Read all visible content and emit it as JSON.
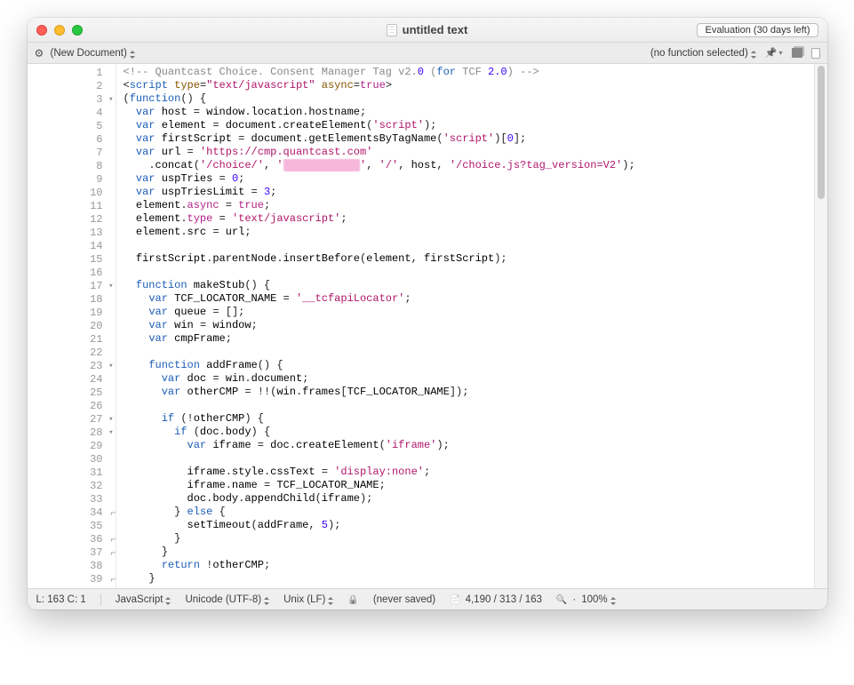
{
  "titlebar": {
    "title": "untitled text",
    "evaluation_badge": "Evaluation (30 days left)"
  },
  "toolbar": {
    "document_dropdown": "(New Document)",
    "function_dropdown": "(no function selected)"
  },
  "gutter": {
    "lines": [
      {
        "n": 1
      },
      {
        "n": 2
      },
      {
        "n": 3,
        "fold": "down"
      },
      {
        "n": 4
      },
      {
        "n": 5
      },
      {
        "n": 6
      },
      {
        "n": 7
      },
      {
        "n": 8
      },
      {
        "n": 9
      },
      {
        "n": 10
      },
      {
        "n": 11
      },
      {
        "n": 12
      },
      {
        "n": 13
      },
      {
        "n": 14
      },
      {
        "n": 15
      },
      {
        "n": 16
      },
      {
        "n": 17,
        "fold": "down"
      },
      {
        "n": 18
      },
      {
        "n": 19
      },
      {
        "n": 20
      },
      {
        "n": 21
      },
      {
        "n": 22
      },
      {
        "n": 23,
        "fold": "down"
      },
      {
        "n": 24
      },
      {
        "n": 25
      },
      {
        "n": 26
      },
      {
        "n": 27,
        "fold": "down"
      },
      {
        "n": 28,
        "fold": "down"
      },
      {
        "n": 29
      },
      {
        "n": 30
      },
      {
        "n": 31
      },
      {
        "n": 32
      },
      {
        "n": 33
      },
      {
        "n": 34,
        "fold": "up"
      },
      {
        "n": 35
      },
      {
        "n": 36,
        "fold": "up"
      },
      {
        "n": 37,
        "fold": "up"
      },
      {
        "n": 38
      },
      {
        "n": 39,
        "fold": "up"
      }
    ]
  },
  "code": {
    "lines": [
      [
        {
          "c": "c-comment",
          "t": "<!-- Quantcast Choice. Consent Manager Tag v2."
        },
        {
          "c": "c-num",
          "t": "0"
        },
        {
          "c": "c-comment",
          "t": " ("
        },
        {
          "c": "c-keyword",
          "t": "for"
        },
        {
          "c": "c-comment",
          "t": " TCF "
        },
        {
          "c": "c-num",
          "t": "2.0"
        },
        {
          "c": "c-comment",
          "t": ") -->"
        }
      ],
      [
        {
          "c": "c-punc",
          "t": "<"
        },
        {
          "c": "c-tag",
          "t": "script"
        },
        {
          "c": "txt",
          "t": " "
        },
        {
          "c": "c-attr",
          "t": "type"
        },
        {
          "c": "c-punc",
          "t": "="
        },
        {
          "c": "c-str2",
          "t": "\"text/javascript\""
        },
        {
          "c": "txt",
          "t": " "
        },
        {
          "c": "c-attr",
          "t": "async"
        },
        {
          "c": "c-punc",
          "t": "="
        },
        {
          "c": "c-bool",
          "t": "true"
        },
        {
          "c": "c-punc",
          "t": ">"
        }
      ],
      [
        {
          "c": "c-punc",
          "t": "("
        },
        {
          "c": "c-keyword",
          "t": "function"
        },
        {
          "c": "c-punc",
          "t": "() {"
        }
      ],
      [
        {
          "c": "txt",
          "t": "  "
        },
        {
          "c": "c-keyword",
          "t": "var"
        },
        {
          "c": "txt",
          "t": " host "
        },
        {
          "c": "c-punc",
          "t": "="
        },
        {
          "c": "txt",
          "t": " window"
        },
        {
          "c": "c-punc",
          "t": "."
        },
        {
          "c": "txt",
          "t": "location"
        },
        {
          "c": "c-punc",
          "t": "."
        },
        {
          "c": "txt",
          "t": "hostname"
        },
        {
          "c": "c-punc",
          "t": ";"
        }
      ],
      [
        {
          "c": "txt",
          "t": "  "
        },
        {
          "c": "c-keyword",
          "t": "var"
        },
        {
          "c": "txt",
          "t": " element "
        },
        {
          "c": "c-punc",
          "t": "="
        },
        {
          "c": "txt",
          "t": " document"
        },
        {
          "c": "c-punc",
          "t": "."
        },
        {
          "c": "txt",
          "t": "createElement"
        },
        {
          "c": "c-punc",
          "t": "("
        },
        {
          "c": "c-str2",
          "t": "'script'"
        },
        {
          "c": "c-punc",
          "t": ");"
        }
      ],
      [
        {
          "c": "txt",
          "t": "  "
        },
        {
          "c": "c-keyword",
          "t": "var"
        },
        {
          "c": "txt",
          "t": " firstScript "
        },
        {
          "c": "c-punc",
          "t": "="
        },
        {
          "c": "txt",
          "t": " document"
        },
        {
          "c": "c-punc",
          "t": "."
        },
        {
          "c": "txt",
          "t": "getElementsByTagName"
        },
        {
          "c": "c-punc",
          "t": "("
        },
        {
          "c": "c-str2",
          "t": "'script'"
        },
        {
          "c": "c-punc",
          "t": ")["
        },
        {
          "c": "c-num",
          "t": "0"
        },
        {
          "c": "c-punc",
          "t": "];"
        }
      ],
      [
        {
          "c": "txt",
          "t": "  "
        },
        {
          "c": "c-keyword",
          "t": "var"
        },
        {
          "c": "txt",
          "t": " url "
        },
        {
          "c": "c-punc",
          "t": "="
        },
        {
          "c": "txt",
          "t": " "
        },
        {
          "c": "c-str2",
          "t": "'https://cmp.quantcast.com'"
        }
      ],
      [
        {
          "c": "txt",
          "t": "    "
        },
        {
          "c": "c-punc",
          "t": "."
        },
        {
          "c": "txt",
          "t": "concat"
        },
        {
          "c": "c-punc",
          "t": "("
        },
        {
          "c": "c-str2",
          "t": "'/choice/'"
        },
        {
          "c": "c-punc",
          "t": ", "
        },
        {
          "c": "c-str2",
          "t": "'"
        },
        {
          "c": "blurred",
          "t": "XXXXXXXXXXXX"
        },
        {
          "c": "c-str2",
          "t": "'"
        },
        {
          "c": "c-punc",
          "t": ", "
        },
        {
          "c": "c-str2",
          "t": "'/'"
        },
        {
          "c": "c-punc",
          "t": ", "
        },
        {
          "c": "txt",
          "t": "host"
        },
        {
          "c": "c-punc",
          "t": ", "
        },
        {
          "c": "c-str2",
          "t": "'/choice.js?tag_version=V2'"
        },
        {
          "c": "c-punc",
          "t": ");"
        }
      ],
      [
        {
          "c": "txt",
          "t": "  "
        },
        {
          "c": "c-keyword",
          "t": "var"
        },
        {
          "c": "txt",
          "t": " uspTries "
        },
        {
          "c": "c-punc",
          "t": "="
        },
        {
          "c": "txt",
          "t": " "
        },
        {
          "c": "c-num",
          "t": "0"
        },
        {
          "c": "c-punc",
          "t": ";"
        }
      ],
      [
        {
          "c": "txt",
          "t": "  "
        },
        {
          "c": "c-keyword",
          "t": "var"
        },
        {
          "c": "txt",
          "t": " uspTriesLimit "
        },
        {
          "c": "c-punc",
          "t": "="
        },
        {
          "c": "txt",
          "t": " "
        },
        {
          "c": "c-num",
          "t": "3"
        },
        {
          "c": "c-punc",
          "t": ";"
        }
      ],
      [
        {
          "c": "txt",
          "t": "  element"
        },
        {
          "c": "c-punc",
          "t": "."
        },
        {
          "c": "c-type",
          "t": "async"
        },
        {
          "c": "txt",
          "t": " "
        },
        {
          "c": "c-punc",
          "t": "="
        },
        {
          "c": "txt",
          "t": " "
        },
        {
          "c": "c-bool",
          "t": "true"
        },
        {
          "c": "c-punc",
          "t": ";"
        }
      ],
      [
        {
          "c": "txt",
          "t": "  element"
        },
        {
          "c": "c-punc",
          "t": "."
        },
        {
          "c": "c-type",
          "t": "type"
        },
        {
          "c": "txt",
          "t": " "
        },
        {
          "c": "c-punc",
          "t": "="
        },
        {
          "c": "txt",
          "t": " "
        },
        {
          "c": "c-str2",
          "t": "'text/javascript'"
        },
        {
          "c": "c-punc",
          "t": ";"
        }
      ],
      [
        {
          "c": "txt",
          "t": "  element"
        },
        {
          "c": "c-punc",
          "t": "."
        },
        {
          "c": "txt",
          "t": "src "
        },
        {
          "c": "c-punc",
          "t": "="
        },
        {
          "c": "txt",
          "t": " url"
        },
        {
          "c": "c-punc",
          "t": ";"
        }
      ],
      [
        {
          "c": "txt",
          "t": ""
        }
      ],
      [
        {
          "c": "txt",
          "t": "  firstScript"
        },
        {
          "c": "c-punc",
          "t": "."
        },
        {
          "c": "txt",
          "t": "parentNode"
        },
        {
          "c": "c-punc",
          "t": "."
        },
        {
          "c": "txt",
          "t": "insertBefore"
        },
        {
          "c": "c-punc",
          "t": "("
        },
        {
          "c": "txt",
          "t": "element"
        },
        {
          "c": "c-punc",
          "t": ", "
        },
        {
          "c": "txt",
          "t": "firstScript"
        },
        {
          "c": "c-punc",
          "t": ");"
        }
      ],
      [
        {
          "c": "txt",
          "t": ""
        }
      ],
      [
        {
          "c": "txt",
          "t": "  "
        },
        {
          "c": "c-keyword",
          "t": "function"
        },
        {
          "c": "txt",
          "t": " makeStub"
        },
        {
          "c": "c-punc",
          "t": "() {"
        }
      ],
      [
        {
          "c": "txt",
          "t": "    "
        },
        {
          "c": "c-keyword",
          "t": "var"
        },
        {
          "c": "txt",
          "t": " TCF_LOCATOR_NAME "
        },
        {
          "c": "c-punc",
          "t": "="
        },
        {
          "c": "txt",
          "t": " "
        },
        {
          "c": "c-str2",
          "t": "'__tcfapiLocator'"
        },
        {
          "c": "c-punc",
          "t": ";"
        }
      ],
      [
        {
          "c": "txt",
          "t": "    "
        },
        {
          "c": "c-keyword",
          "t": "var"
        },
        {
          "c": "txt",
          "t": " queue "
        },
        {
          "c": "c-punc",
          "t": "="
        },
        {
          "c": "txt",
          "t": " "
        },
        {
          "c": "c-punc",
          "t": "[];"
        }
      ],
      [
        {
          "c": "txt",
          "t": "    "
        },
        {
          "c": "c-keyword",
          "t": "var"
        },
        {
          "c": "txt",
          "t": " win "
        },
        {
          "c": "c-punc",
          "t": "="
        },
        {
          "c": "txt",
          "t": " window"
        },
        {
          "c": "c-punc",
          "t": ";"
        }
      ],
      [
        {
          "c": "txt",
          "t": "    "
        },
        {
          "c": "c-keyword",
          "t": "var"
        },
        {
          "c": "txt",
          "t": " cmpFrame"
        },
        {
          "c": "c-punc",
          "t": ";"
        }
      ],
      [
        {
          "c": "txt",
          "t": ""
        }
      ],
      [
        {
          "c": "txt",
          "t": "    "
        },
        {
          "c": "c-keyword",
          "t": "function"
        },
        {
          "c": "txt",
          "t": " addFrame"
        },
        {
          "c": "c-punc",
          "t": "() {"
        }
      ],
      [
        {
          "c": "txt",
          "t": "      "
        },
        {
          "c": "c-keyword",
          "t": "var"
        },
        {
          "c": "txt",
          "t": " doc "
        },
        {
          "c": "c-punc",
          "t": "="
        },
        {
          "c": "txt",
          "t": " win"
        },
        {
          "c": "c-punc",
          "t": "."
        },
        {
          "c": "txt",
          "t": "document"
        },
        {
          "c": "c-punc",
          "t": ";"
        }
      ],
      [
        {
          "c": "txt",
          "t": "      "
        },
        {
          "c": "c-keyword",
          "t": "var"
        },
        {
          "c": "txt",
          "t": " otherCMP "
        },
        {
          "c": "c-punc",
          "t": "="
        },
        {
          "c": "txt",
          "t": " "
        },
        {
          "c": "c-punc",
          "t": "!!"
        },
        {
          "c": "c-punc",
          "t": "("
        },
        {
          "c": "txt",
          "t": "win"
        },
        {
          "c": "c-punc",
          "t": "."
        },
        {
          "c": "txt",
          "t": "frames"
        },
        {
          "c": "c-punc",
          "t": "["
        },
        {
          "c": "txt",
          "t": "TCF_LOCATOR_NAME"
        },
        {
          "c": "c-punc",
          "t": "]);"
        }
      ],
      [
        {
          "c": "txt",
          "t": ""
        }
      ],
      [
        {
          "c": "txt",
          "t": "      "
        },
        {
          "c": "c-keyword",
          "t": "if"
        },
        {
          "c": "txt",
          "t": " "
        },
        {
          "c": "c-punc",
          "t": "(!"
        },
        {
          "c": "txt",
          "t": "otherCMP"
        },
        {
          "c": "c-punc",
          "t": ") {"
        }
      ],
      [
        {
          "c": "txt",
          "t": "        "
        },
        {
          "c": "c-keyword",
          "t": "if"
        },
        {
          "c": "txt",
          "t": " "
        },
        {
          "c": "c-punc",
          "t": "("
        },
        {
          "c": "txt",
          "t": "doc"
        },
        {
          "c": "c-punc",
          "t": "."
        },
        {
          "c": "txt",
          "t": "body"
        },
        {
          "c": "c-punc",
          "t": ") {"
        }
      ],
      [
        {
          "c": "txt",
          "t": "          "
        },
        {
          "c": "c-keyword",
          "t": "var"
        },
        {
          "c": "txt",
          "t": " iframe "
        },
        {
          "c": "c-punc",
          "t": "="
        },
        {
          "c": "txt",
          "t": " doc"
        },
        {
          "c": "c-punc",
          "t": "."
        },
        {
          "c": "txt",
          "t": "createElement"
        },
        {
          "c": "c-punc",
          "t": "("
        },
        {
          "c": "c-str2",
          "t": "'iframe'"
        },
        {
          "c": "c-punc",
          "t": ");"
        }
      ],
      [
        {
          "c": "txt",
          "t": ""
        }
      ],
      [
        {
          "c": "txt",
          "t": "          iframe"
        },
        {
          "c": "c-punc",
          "t": "."
        },
        {
          "c": "txt",
          "t": "style"
        },
        {
          "c": "c-punc",
          "t": "."
        },
        {
          "c": "txt",
          "t": "cssText "
        },
        {
          "c": "c-punc",
          "t": "="
        },
        {
          "c": "txt",
          "t": " "
        },
        {
          "c": "c-str2",
          "t": "'display:none'"
        },
        {
          "c": "c-punc",
          "t": ";"
        }
      ],
      [
        {
          "c": "txt",
          "t": "          iframe"
        },
        {
          "c": "c-punc",
          "t": "."
        },
        {
          "c": "txt",
          "t": "name "
        },
        {
          "c": "c-punc",
          "t": "="
        },
        {
          "c": "txt",
          "t": " TCF_LOCATOR_NAME"
        },
        {
          "c": "c-punc",
          "t": ";"
        }
      ],
      [
        {
          "c": "txt",
          "t": "          doc"
        },
        {
          "c": "c-punc",
          "t": "."
        },
        {
          "c": "txt",
          "t": "body"
        },
        {
          "c": "c-punc",
          "t": "."
        },
        {
          "c": "txt",
          "t": "appendChild"
        },
        {
          "c": "c-punc",
          "t": "("
        },
        {
          "c": "txt",
          "t": "iframe"
        },
        {
          "c": "c-punc",
          "t": ");"
        }
      ],
      [
        {
          "c": "txt",
          "t": "        "
        },
        {
          "c": "c-punc",
          "t": "}"
        },
        {
          "c": "txt",
          "t": " "
        },
        {
          "c": "c-keyword",
          "t": "else"
        },
        {
          "c": "txt",
          "t": " "
        },
        {
          "c": "c-punc",
          "t": "{"
        }
      ],
      [
        {
          "c": "txt",
          "t": "          setTimeout"
        },
        {
          "c": "c-punc",
          "t": "("
        },
        {
          "c": "txt",
          "t": "addFrame"
        },
        {
          "c": "c-punc",
          "t": ", "
        },
        {
          "c": "c-num",
          "t": "5"
        },
        {
          "c": "c-punc",
          "t": ");"
        }
      ],
      [
        {
          "c": "txt",
          "t": "        "
        },
        {
          "c": "c-punc",
          "t": "}"
        }
      ],
      [
        {
          "c": "txt",
          "t": "      "
        },
        {
          "c": "c-punc",
          "t": "}"
        }
      ],
      [
        {
          "c": "txt",
          "t": "      "
        },
        {
          "c": "c-keyword",
          "t": "return"
        },
        {
          "c": "txt",
          "t": " "
        },
        {
          "c": "c-punc",
          "t": "!"
        },
        {
          "c": "txt",
          "t": "otherCMP"
        },
        {
          "c": "c-punc",
          "t": ";"
        }
      ],
      [
        {
          "c": "txt",
          "t": "    "
        },
        {
          "c": "c-punc",
          "t": "}"
        }
      ]
    ]
  },
  "statusbar": {
    "cursor": "L: 163 C: 1",
    "language": "JavaScript",
    "encoding": "Unicode (UTF-8)",
    "line_endings": "Unix (LF)",
    "save_state": "(never saved)",
    "counts": "4,190 / 313 / 163",
    "zoom": "100%"
  }
}
